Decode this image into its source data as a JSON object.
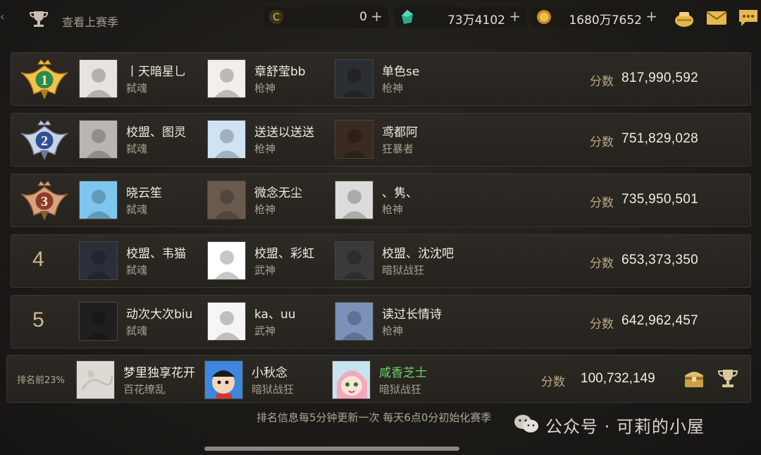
{
  "header": {
    "last_season_label": "查看上赛季",
    "currencies": [
      {
        "icon": "coupon-icon",
        "value": "0"
      },
      {
        "icon": "gem-icon",
        "value": "73万4102"
      },
      {
        "icon": "gold-coin-icon",
        "value": "1680万7652"
      }
    ],
    "plus": "+",
    "icons": [
      "treasure-bag-icon",
      "mail-icon",
      "chat-icon"
    ]
  },
  "score_label": "分数",
  "rows": [
    {
      "rank": "1",
      "players": [
        {
          "name": "丨天暗星乚",
          "class": "弑魂"
        },
        {
          "name": "章舒莹bb",
          "class": "枪神"
        },
        {
          "name": "单色se",
          "class": "枪神"
        }
      ],
      "score": "817,990,592"
    },
    {
      "rank": "2",
      "players": [
        {
          "name": "校盟、图灵",
          "class": "弑魂"
        },
        {
          "name": "送送以送送",
          "class": "枪神"
        },
        {
          "name": "鸢都阿",
          "class": "狂暴者"
        }
      ],
      "score": "751,829,028"
    },
    {
      "rank": "3",
      "players": [
        {
          "name": "晓云笙",
          "class": "弑魂"
        },
        {
          "name": "微念无尘",
          "class": "枪神"
        },
        {
          "name": "、隽、",
          "class": "枪神"
        }
      ],
      "score": "735,950,501"
    },
    {
      "rank": "4",
      "players": [
        {
          "name": "校盟、韦猫",
          "class": "弑魂"
        },
        {
          "name": "校盟、彩虹",
          "class": "武神"
        },
        {
          "name": "校盟、沈沈吧",
          "class": "暗狱战狂"
        }
      ],
      "score": "653,373,350"
    },
    {
      "rank": "5",
      "players": [
        {
          "name": "动次大次biu",
          "class": "弑魂"
        },
        {
          "name": "ka、uu",
          "class": "武神"
        },
        {
          "name": "读过长情诗",
          "class": "枪神"
        }
      ],
      "score": "642,962,457"
    }
  ],
  "self": {
    "rank_text": "排名前23%",
    "players": [
      {
        "name": "梦里独享花开",
        "class": "百花缭乱"
      },
      {
        "name": "小秋念",
        "class": "暗狱战狂"
      },
      {
        "name": "咸香芝士",
        "class": "暗狱战狂",
        "highlight": "#6fd26a"
      }
    ],
    "score": "100,732,149"
  },
  "footer_note": "排名信息每5分钟更新一次 每天6点0分初始化赛季",
  "watermark": "公众号 · 可莉的小屋",
  "colors": {
    "gold": "#c9b98f",
    "highlight_green": "#6fd26a",
    "row_bg": "#2a2722"
  }
}
